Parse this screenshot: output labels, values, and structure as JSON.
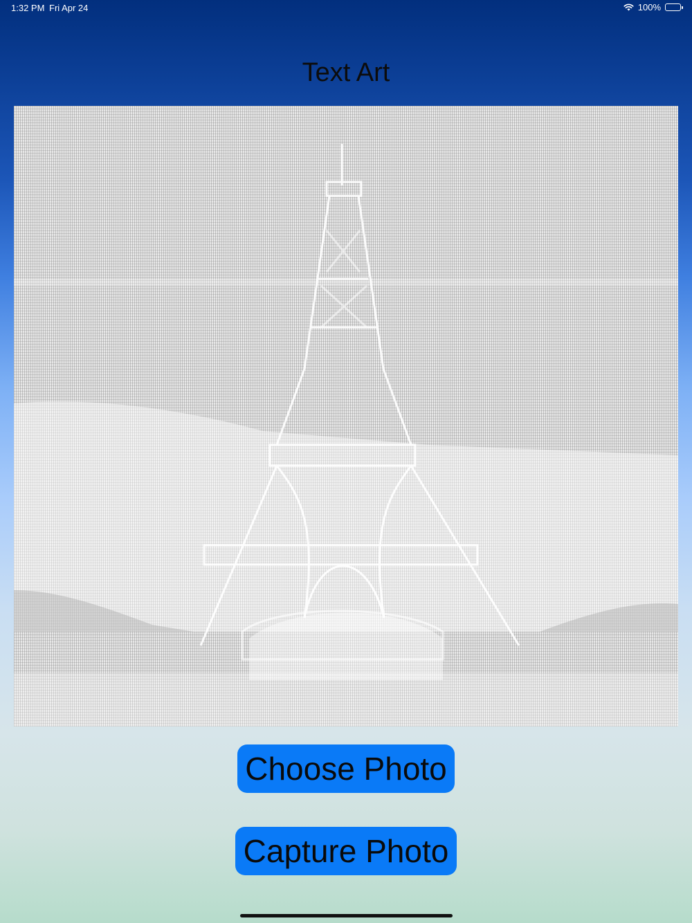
{
  "status_bar": {
    "time": "1:32 PM",
    "date": "Fri Apr 24",
    "battery_percent": "100%",
    "icons": [
      "wifi-icon",
      "battery-icon"
    ]
  },
  "title": "Text Art",
  "buttons": {
    "choose_photo": "Choose Photo",
    "capture_photo": "Capture Photo"
  },
  "colors": {
    "button_background": "#0a7af7",
    "gradient_top": "#022f7e",
    "gradient_bottom": "#b6dccb"
  }
}
